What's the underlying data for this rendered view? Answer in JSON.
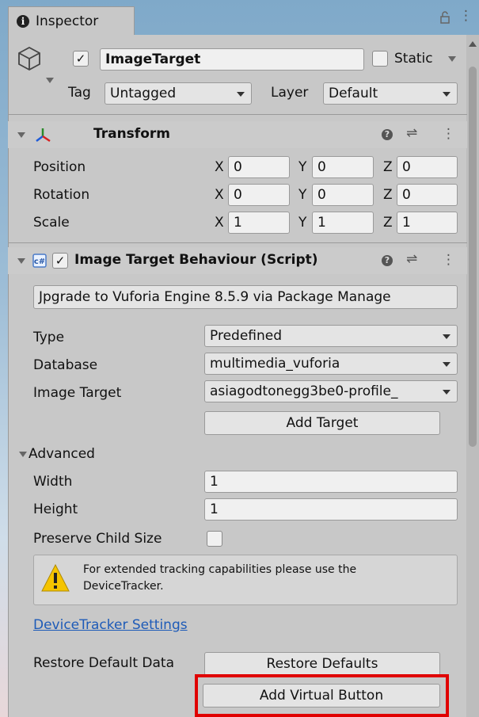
{
  "window": {
    "tab_title": "Inspector"
  },
  "gameobject": {
    "enabled_check": "✓",
    "name": "ImageTarget",
    "static_label": "Static",
    "tag_label": "Tag",
    "tag_value": "Untagged",
    "layer_label": "Layer",
    "layer_value": "Default"
  },
  "transform": {
    "title": "Transform",
    "rows": [
      {
        "label": "Position",
        "x": "0",
        "y": "0",
        "z": "0"
      },
      {
        "label": "Rotation",
        "x": "0",
        "y": "0",
        "z": "0"
      },
      {
        "label": "Scale",
        "x": "1",
        "y": "1",
        "z": "1"
      }
    ],
    "axis_x": "X",
    "axis_y": "Y",
    "axis_z": "Z"
  },
  "behaviour": {
    "enabled_check": "✓",
    "title": "Image Target Behaviour (Script)",
    "upgrade_button": "Jpgrade to Vuforia Engine 8.5.9 via Package Manage",
    "type_label": "Type",
    "type_value": "Predefined",
    "database_label": "Database",
    "database_value": "multimedia_vuforia",
    "image_target_label": "Image Target",
    "image_target_value": "asiagodtonegg3be0-profile_",
    "add_target_button": "Add Target",
    "advanced_label": "Advanced",
    "width_label": "Width",
    "width_value": "1",
    "height_label": "Height",
    "height_value": "1",
    "preserve_label": "Preserve Child Size",
    "warning_text_1": "For extended tracking capabilities please use the",
    "warning_text_2": "DeviceTracker.",
    "device_tracker_link": "DeviceTracker Settings",
    "restore_label": "Restore Default Data",
    "restore_button": "Restore Defaults",
    "add_virtual_button": "Add Virtual Button"
  },
  "colors": {
    "highlight": "#e00000",
    "link": "#1e5bb8"
  }
}
